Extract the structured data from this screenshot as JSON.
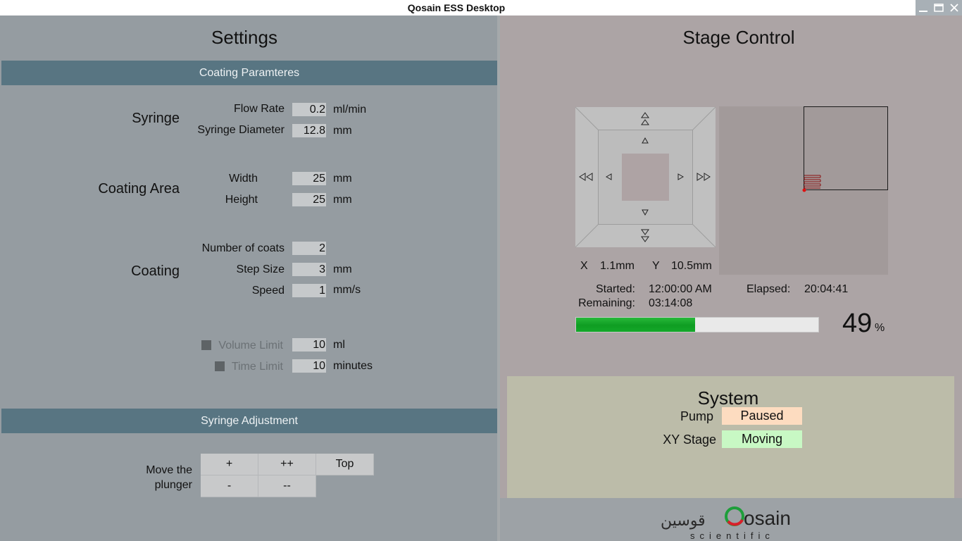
{
  "window": {
    "title": "Qosain ESS Desktop"
  },
  "settings": {
    "heading": "Settings",
    "coating_params_band": "Coating Paramteres",
    "syringe": {
      "group": "Syringe",
      "flow_rate_label": "Flow Rate",
      "flow_rate_value": "0.2",
      "flow_rate_unit": "ml/min",
      "diameter_label": "Syringe Diameter",
      "diameter_value": "12.8",
      "diameter_unit": "mm"
    },
    "coating_area": {
      "group": "Coating Area",
      "width_label": "Width",
      "width_value": "25",
      "width_unit": "mm",
      "height_label": "Height",
      "height_value": "25",
      "height_unit": "mm"
    },
    "coating": {
      "group": "Coating",
      "coats_label": "Number of coats",
      "coats_value": "2",
      "step_label": "Step Size",
      "step_value": "3",
      "step_unit": "mm",
      "speed_label": "Speed",
      "speed_value": "1",
      "speed_unit": "mm/s"
    },
    "limits": {
      "volume_label": "Volume Limit",
      "volume_value": "10",
      "volume_unit": "ml",
      "volume_checked": false,
      "time_label": "Time Limit",
      "time_value": "10",
      "time_unit": "minutes",
      "time_checked": false
    },
    "syringe_adjust_band": "Syringe Adjustment",
    "plunger": {
      "label_line1": "Move the",
      "label_line2": "plunger",
      "plus": "+",
      "plus_plus": "++",
      "top": "Top",
      "minus": "-",
      "minus_minus": "--"
    }
  },
  "stage": {
    "heading": "Stage Control",
    "x_label": "X",
    "x_value": "1.1mm",
    "y_label": "Y",
    "y_value": "10.5mm",
    "started_label": "Started:",
    "started_value": "12:00:00 AM",
    "elapsed_label": "Elapsed:",
    "elapsed_value": "20:04:41",
    "remaining_label": "Remaining:",
    "remaining_value": "03:14:08",
    "progress_percent": 49,
    "progress_text": "49",
    "percent_sign": "%",
    "jog_icons": [
      "up-fast-icon",
      "up-icon",
      "left-fast-icon",
      "left-icon",
      "right-icon",
      "right-fast-icon",
      "down-icon",
      "down-fast-icon"
    ]
  },
  "system": {
    "heading": "System",
    "pump_label": "Pump",
    "pump_status": "Paused",
    "pump_color": "#fddcc0",
    "stage_label": "XY Stage",
    "stage_status": "Moving",
    "stage_color": "#c8f8c4"
  },
  "brand": {
    "logo_text": "Qosain",
    "logo_sub": "scientific",
    "logo_arabic": "قوسین",
    "accent_green": "#1e9e3a",
    "accent_red": "#d8202a"
  }
}
